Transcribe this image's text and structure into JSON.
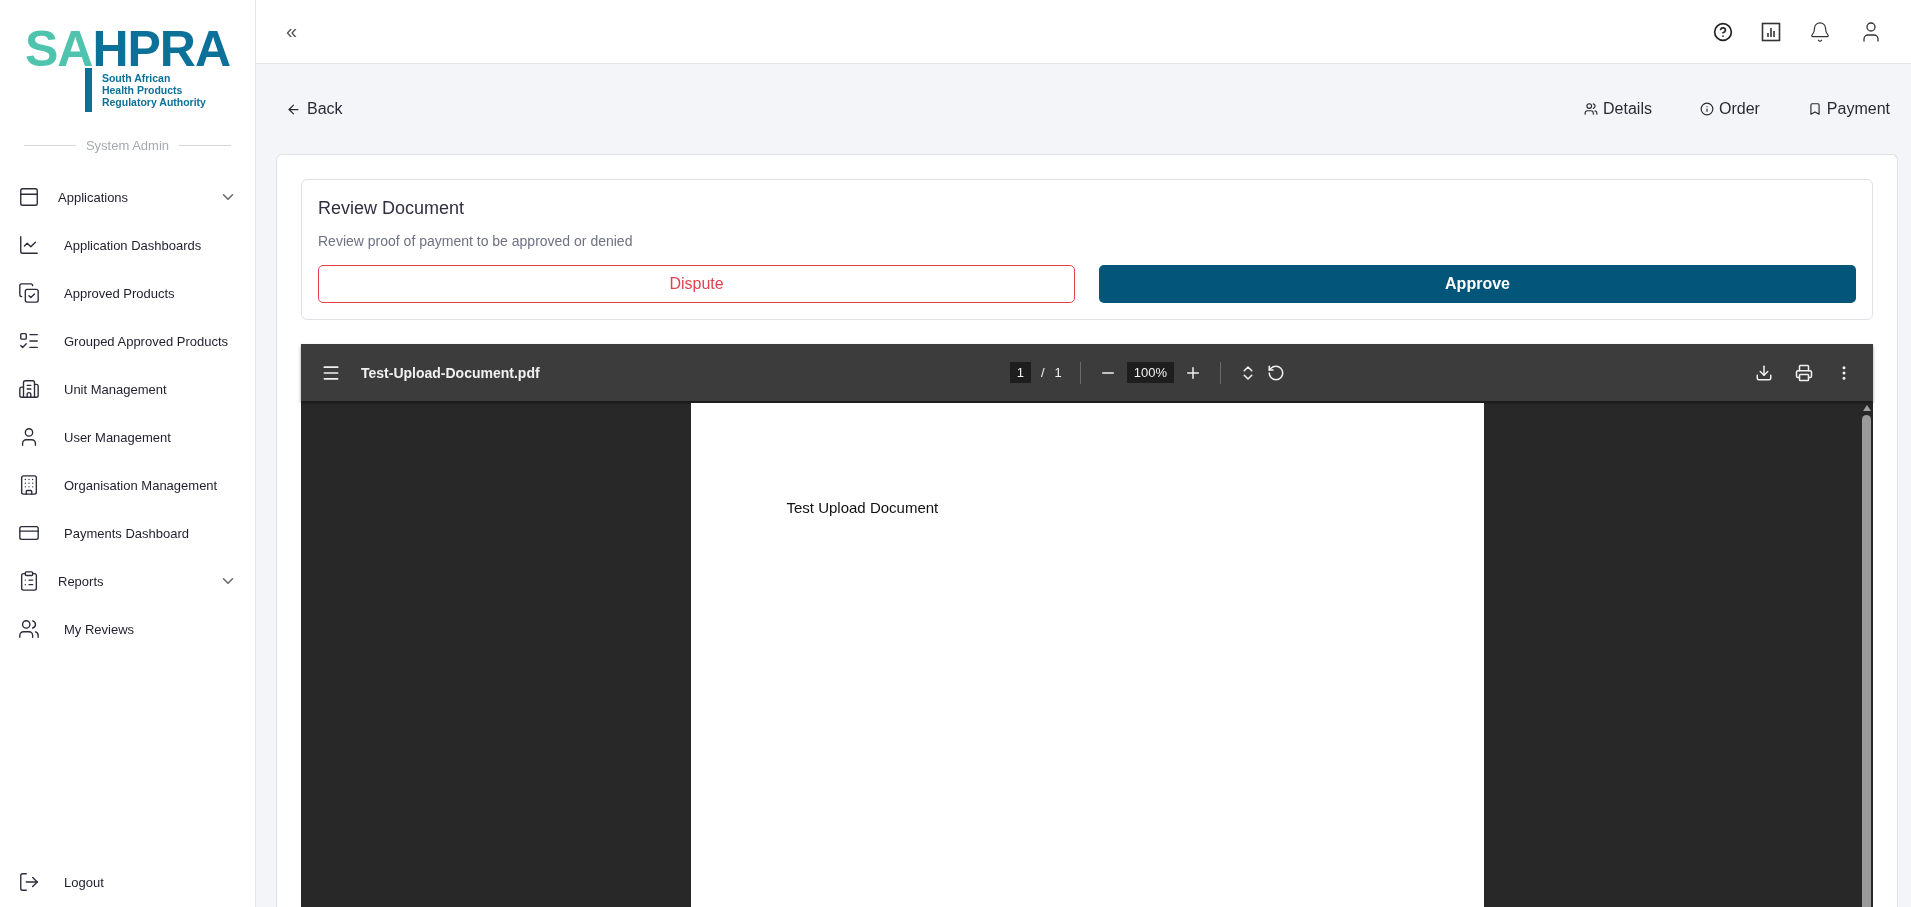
{
  "logo": {
    "mark_left": "SA",
    "mark_right": "HPRA",
    "tagline": [
      "South African",
      "Health Products",
      "Regulatory Authority"
    ]
  },
  "sidebar": {
    "role": "System Admin",
    "items": [
      {
        "kind": "group",
        "label": "Applications"
      },
      {
        "kind": "link",
        "label": "Application Dashboards"
      },
      {
        "kind": "link",
        "label": "Approved Products"
      },
      {
        "kind": "link",
        "label": "Grouped Approved Products"
      },
      {
        "kind": "link",
        "label": "Unit Management"
      },
      {
        "kind": "link",
        "label": "User Management"
      },
      {
        "kind": "link",
        "label": "Organisation Management"
      },
      {
        "kind": "link",
        "label": "Payments Dashboard"
      },
      {
        "kind": "group",
        "label": "Reports"
      },
      {
        "kind": "link",
        "label": "My Reviews"
      }
    ],
    "logout": "Logout"
  },
  "topbar": {
    "collapse": "«"
  },
  "page": {
    "back": "Back",
    "tabs": [
      "Details",
      "Order",
      "Payment"
    ]
  },
  "review": {
    "title": "Review Document",
    "subtitle": "Review proof of payment to be approved or denied",
    "dispute": "Dispute",
    "approve": "Approve"
  },
  "pdf": {
    "filename": "Test-Upload-Document.pdf",
    "page": "1",
    "separator": "/",
    "pages": "1",
    "zoom": "100%",
    "content": "Test Upload Document"
  }
}
